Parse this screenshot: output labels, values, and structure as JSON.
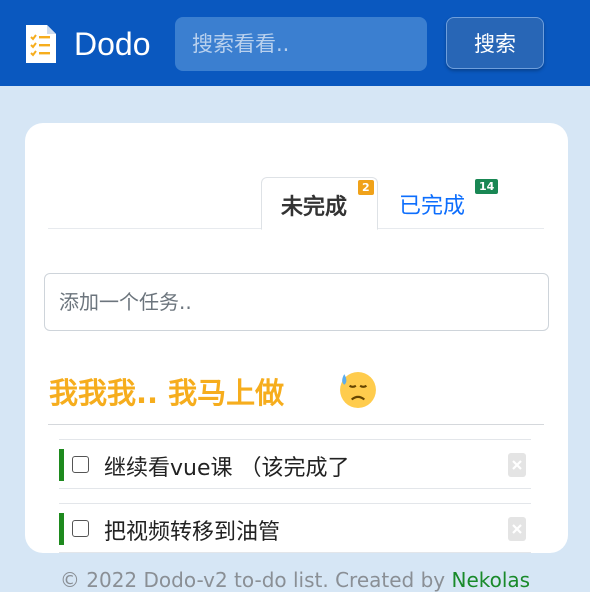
{
  "header": {
    "brand": "Dodo",
    "search": {
      "placeholder": "搜索看看.."
    },
    "search_button": "搜索",
    "icons": {
      "logo": "checklist-document-icon"
    },
    "colors": {
      "background": "#0a58bf",
      "input": "#3b7fd0",
      "button": "#2866b6"
    }
  },
  "tabs": [
    {
      "label": "未完成",
      "count": "2",
      "active": true
    },
    {
      "label": "已完成",
      "count": "14",
      "active": false
    }
  ],
  "add_task": {
    "placeholder": "添加一个任务.."
  },
  "section": {
    "title": "我我我.. 我马上做",
    "emoji": "downcast-face-with-sweat-icon",
    "title_color": "#f6ad1d"
  },
  "tasks": [
    {
      "text": "继续看vue课 （该完成了",
      "checked": false
    },
    {
      "text": "把视频转移到油管",
      "checked": false
    }
  ],
  "footer": {
    "text": "© 2022 Dodo-v2 to-do list. Created by ",
    "author": "Nekolas"
  }
}
